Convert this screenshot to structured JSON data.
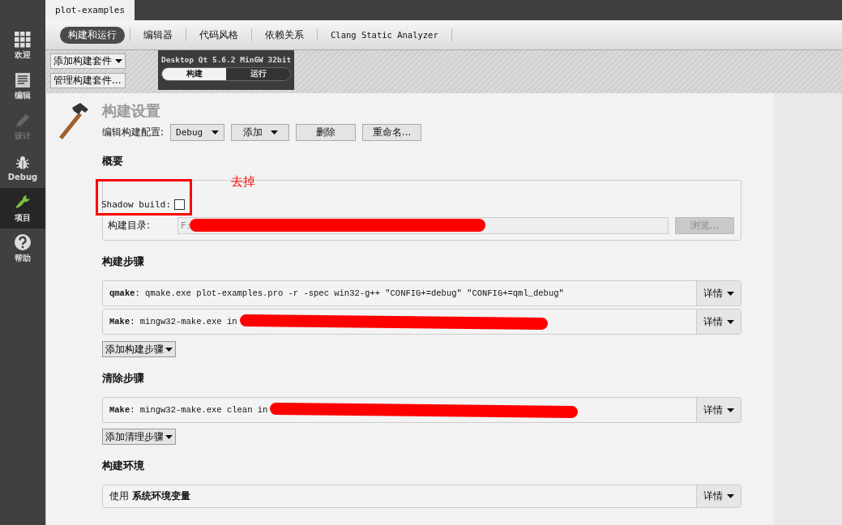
{
  "project_tab": {
    "label": "plot-examples"
  },
  "sidebar": {
    "items": [
      {
        "kind": "welcome",
        "label": "欢迎",
        "selected": false,
        "disabled": false
      },
      {
        "kind": "edit",
        "label": "编辑",
        "selected": false,
        "disabled": false
      },
      {
        "kind": "design",
        "label": "设计",
        "selected": false,
        "disabled": true
      },
      {
        "kind": "debug",
        "label": "Debug",
        "selected": false,
        "disabled": false
      },
      {
        "kind": "projects",
        "label": "项目",
        "selected": true,
        "disabled": false
      },
      {
        "kind": "help",
        "label": "帮助",
        "selected": false,
        "disabled": false
      }
    ]
  },
  "tabs": [
    {
      "label": "构建和运行",
      "selected": true
    },
    {
      "label": "编辑器",
      "selected": false
    },
    {
      "label": "代码风格",
      "selected": false
    },
    {
      "label": "依赖关系",
      "selected": false
    },
    {
      "label": "Clang Static Analyzer",
      "selected": false
    }
  ],
  "kit_buttons": [
    "添加构建套件",
    "管理构建套件..."
  ],
  "kit": {
    "name": "Desktop Qt 5.6.2 MinGW 32bit",
    "modes": [
      {
        "label": "构建",
        "selected": true
      },
      {
        "label": "运行",
        "selected": false
      }
    ]
  },
  "build_settings": {
    "title": "构建设置",
    "config_label": "编辑构建配置:",
    "config_value": "Debug",
    "add_button": "添加",
    "delete_button": "删除",
    "rename_button": "重命名..."
  },
  "overview": {
    "heading": "概要",
    "shadow_build": {
      "label": "Shadow build:",
      "checked": false
    },
    "build_dir": {
      "label": "构建目录:",
      "value": "F:",
      "redacted": true
    },
    "browse_button": {
      "label": "浏览...",
      "disabled": true
    }
  },
  "annotation": {
    "text": "去掉"
  },
  "build_steps": {
    "heading": "构建步骤",
    "steps": [
      {
        "text": "**qmake**: qmake.exe plot-examples.pro -r -spec win32-g++ \"CONFIG+=debug\" \"CONFIG+=qml_debug\"",
        "redacted": false,
        "details": "详情"
      },
      {
        "text": "**Make**: mingw32-make.exe in",
        "redacted": true,
        "details": "详情"
      }
    ],
    "add_button": "添加构建步骤"
  },
  "clean_steps": {
    "heading": "清除步骤",
    "steps": [
      {
        "text": "**Make**: mingw32-make.exe clean in",
        "redacted": true,
        "details": "详情"
      }
    ],
    "add_button": "添加清理步骤"
  },
  "build_env": {
    "heading": "构建环境",
    "text": "使用 **系统环境变量**",
    "details": "详情"
  }
}
